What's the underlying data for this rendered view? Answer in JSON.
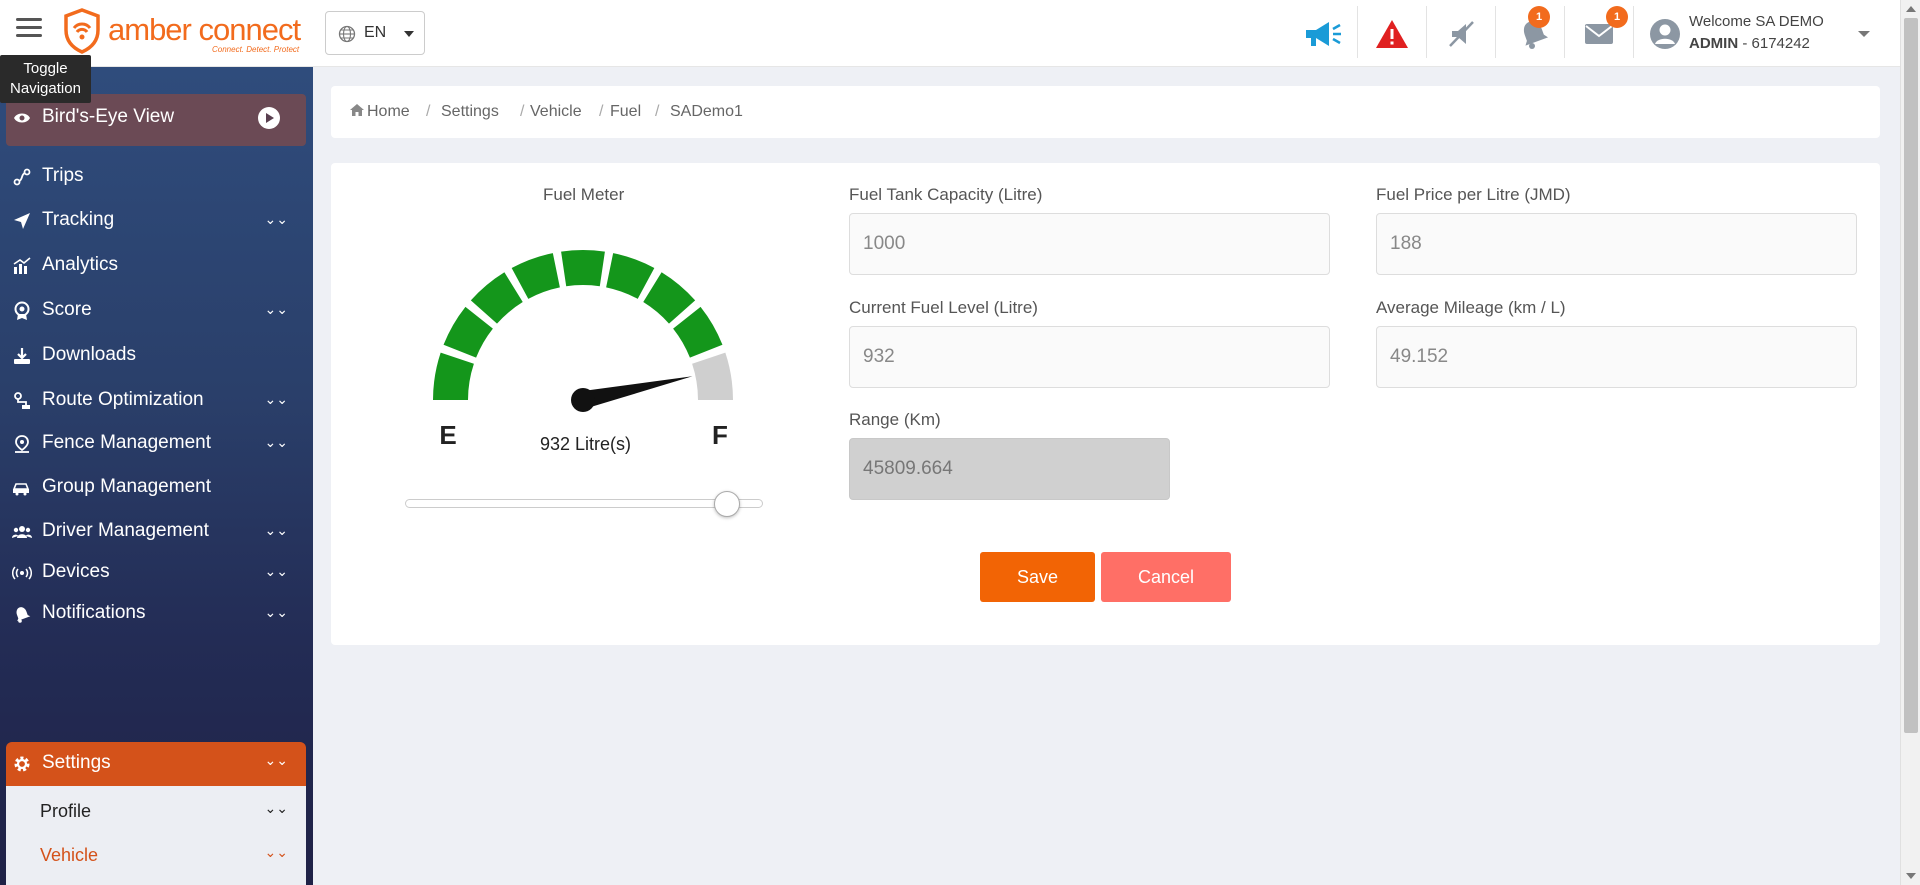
{
  "header": {
    "logo_text": "amber connect",
    "logo_tagline": "Connect. Detect. Protect",
    "language": "EN",
    "alerts_badge": "1",
    "messages_badge": "1",
    "welcome": "Welcome SA DEMO",
    "role": "ADMIN",
    "account_id": "- 6174242",
    "tooltip_line1": "Toggle",
    "tooltip_line2": "Navigation",
    "colors": {
      "brand": "#f26b1d",
      "announce": "#1a9bd7",
      "alert": "#e02020"
    }
  },
  "sidebar": {
    "items": [
      {
        "label": "Bird's-Eye View",
        "icon": "eye-icon"
      },
      {
        "label": "Trips",
        "icon": "route-icon"
      },
      {
        "label": "Tracking",
        "icon": "location-arrow-icon"
      },
      {
        "label": "Analytics",
        "icon": "analytics-icon"
      },
      {
        "label": "Score",
        "icon": "award-icon"
      },
      {
        "label": "Downloads",
        "icon": "download-icon"
      },
      {
        "label": "Route Optimization",
        "icon": "route-optimization-icon"
      },
      {
        "label": "Fence Management",
        "icon": "map-pin-icon"
      },
      {
        "label": "Group Management",
        "icon": "vehicles-icon"
      },
      {
        "label": "Driver Management",
        "icon": "users-icon"
      },
      {
        "label": "Devices",
        "icon": "broadcast-icon"
      },
      {
        "label": "Notifications",
        "icon": "bell-icon"
      },
      {
        "label": "Settings",
        "icon": "gear-icon"
      }
    ],
    "submenu": [
      {
        "label": "Profile"
      },
      {
        "label": "Vehicle"
      }
    ]
  },
  "breadcrumb": [
    "Home",
    "Settings",
    "Vehicle",
    "Fuel",
    "SADemo1"
  ],
  "fuel_meter": {
    "title": "Fuel Meter",
    "readout": "932 Litre(s)",
    "empty_label": "E",
    "full_label": "F",
    "level_fraction": 0.932,
    "colors": {
      "filled": "#14961b",
      "empty": "#cfcfcf",
      "needle": "#111111"
    }
  },
  "form": {
    "tank_capacity_label": "Fuel Tank Capacity (Litre)",
    "tank_capacity_value": "1000",
    "fuel_price_label": "Fuel Price per Litre (JMD)",
    "fuel_price_value": "188",
    "current_level_label": "Current Fuel Level (Litre)",
    "current_level_value": "932",
    "avg_mileage_label": "Average Mileage (km / L)",
    "avg_mileage_value": "49.152",
    "range_label": "Range (Km)",
    "range_value": "45809.664",
    "save_label": "Save",
    "cancel_label": "Cancel",
    "colors": {
      "save": "#f26405",
      "cancel": "#ff6f66"
    }
  }
}
